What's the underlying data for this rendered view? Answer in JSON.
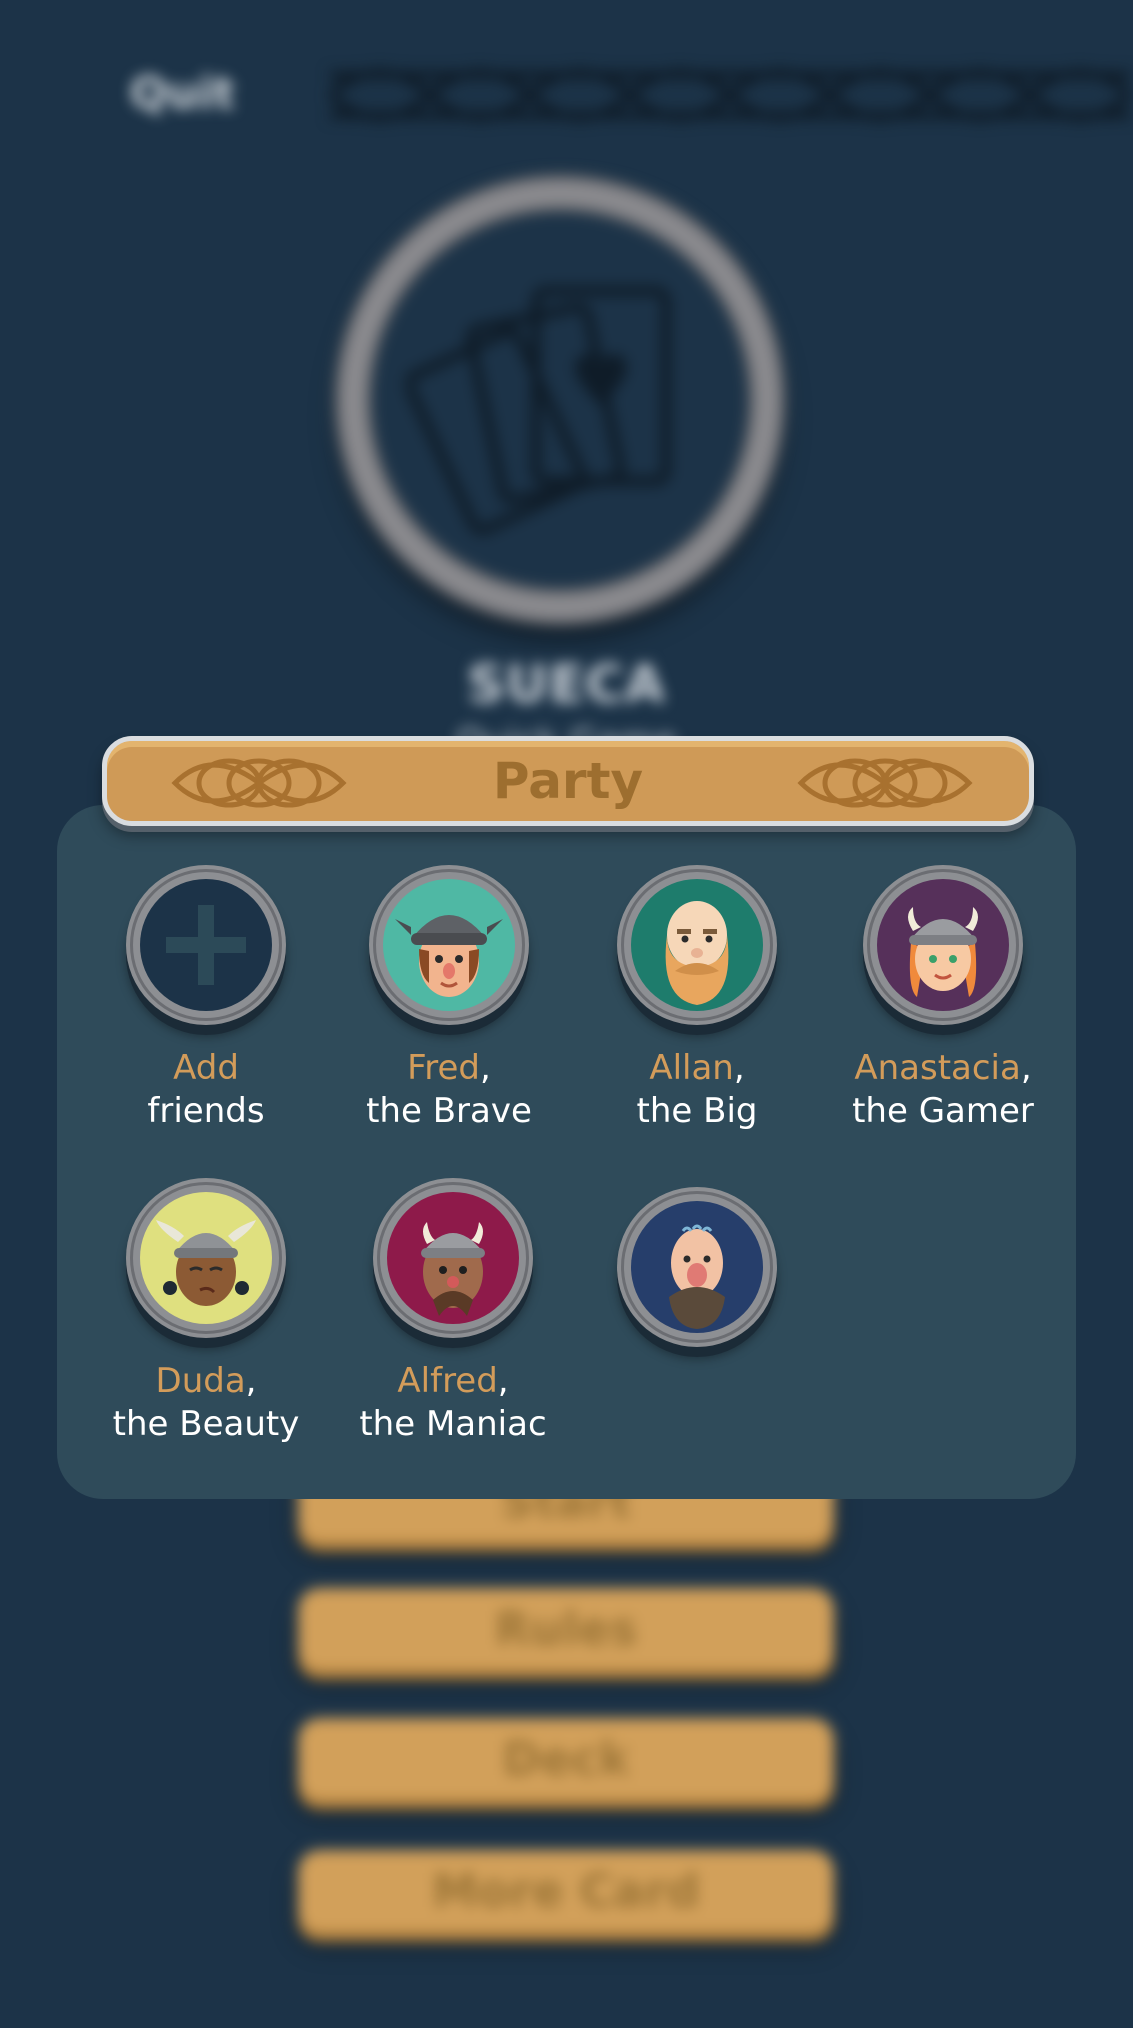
{
  "header": {
    "quit_label": "Quit"
  },
  "game": {
    "title": "SUECA",
    "subtitle": "Quick Game"
  },
  "menu": {
    "buttons": [
      {
        "label": "Start"
      },
      {
        "label": "Rules"
      },
      {
        "label": "Deck"
      },
      {
        "label": "More Card"
      }
    ]
  },
  "party": {
    "title": "Party",
    "add": {
      "line1": "Add",
      "line2": "friends"
    },
    "members": [
      {
        "name": "Fred",
        "sep": ",",
        "title": "the Brave",
        "avatar_color": "#4fb8a4"
      },
      {
        "name": "Allan",
        "sep": ",",
        "title": "the Big",
        "avatar_color": "#1e7c6c"
      },
      {
        "name": "Anastacia",
        "sep": ",",
        "title": "the Gamer",
        "avatar_color": "#56305a"
      },
      {
        "name": "Duda",
        "sep": ",",
        "title": "the Beauty",
        "avatar_color": "#dfe07f"
      },
      {
        "name": "Alfred",
        "sep": ",",
        "title": "the Maniac",
        "avatar_color": "#8e1a4a"
      },
      {
        "avatar_color": "#263e6b"
      }
    ]
  },
  "colors": {
    "background": "#1c3348",
    "panel": "#2f4b5a",
    "accent_gold": "#d39c5a",
    "banner": "#cf9a57"
  },
  "icons": {
    "add": "plus-icon",
    "knot": "celtic-knot-icon",
    "logo": "playing-cards-icon"
  }
}
